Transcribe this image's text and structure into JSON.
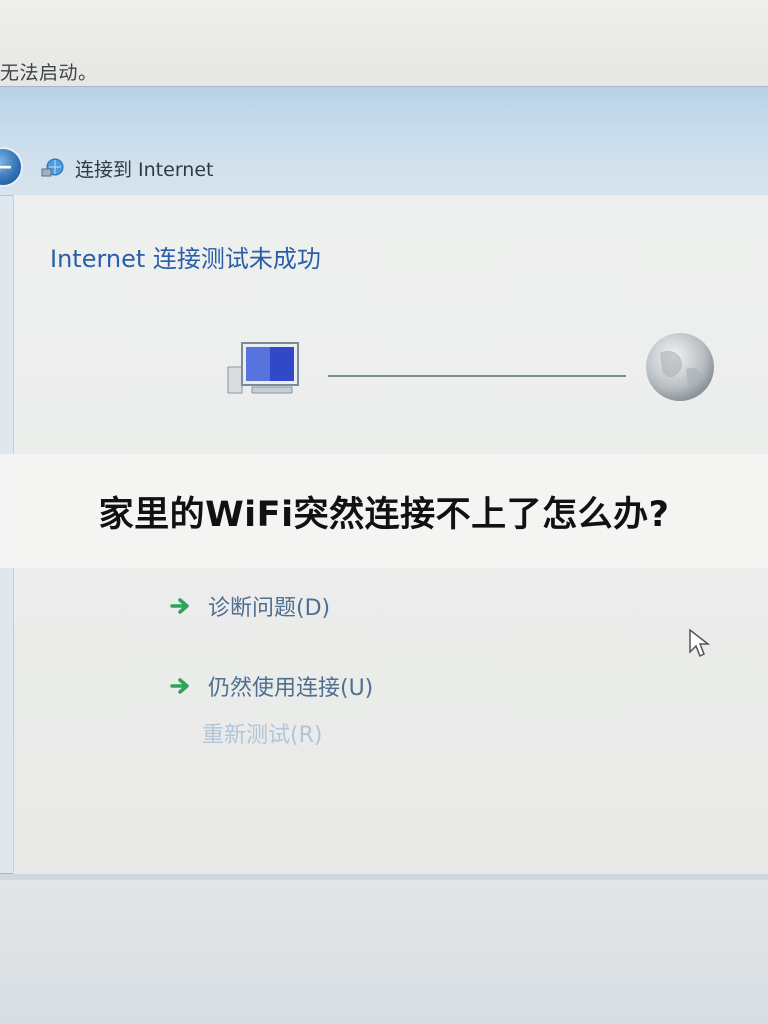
{
  "background": {
    "status_text": "无法启动。"
  },
  "window": {
    "nav_title": "连接到 Internet",
    "back_icon": "back-arrow-icon",
    "network_icon": "network-connection-icon"
  },
  "content": {
    "heading": "Internet 连接测试未成功",
    "hidden_option": "重新测试(R)",
    "options": [
      {
        "label": "诊断问题(D)"
      },
      {
        "label": "仍然使用连接(U)"
      }
    ]
  },
  "banner": {
    "text": "家里的WiFi突然连接不上了怎么办?"
  },
  "colors": {
    "heading": "#2a5fa8",
    "arrow": "#2fa35c",
    "option_text": "#4f6f91"
  }
}
